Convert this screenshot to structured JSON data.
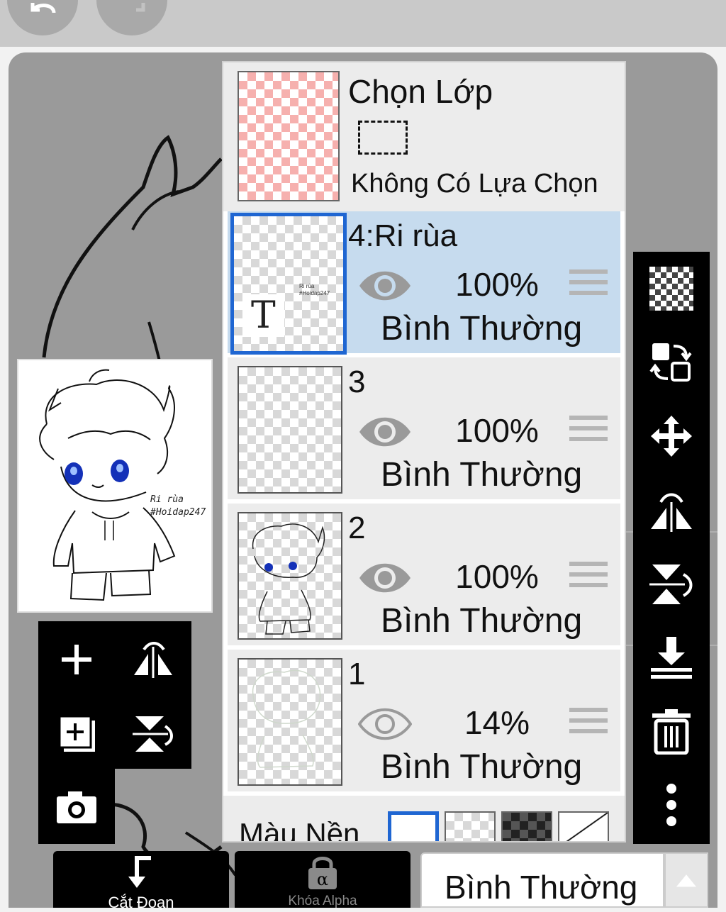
{
  "toolbar": {
    "undo": "undo-icon",
    "redo": "redo-icon"
  },
  "preview": {
    "signature_line1": "Ri rùa",
    "signature_line2": "#Hoidap247"
  },
  "layer_panel": {
    "selection": {
      "title": "Chọn Lớp",
      "status": "Không Có Lựa Chọn"
    },
    "layers": [
      {
        "name": "4:Ri rùa",
        "opacity": "100%",
        "blend": "Bình Thường",
        "visible": true,
        "selected": true,
        "text_layer_marker": "T",
        "thumb_text1": "Ri rùa",
        "thumb_text2": "#Hoidap247"
      },
      {
        "name": "3",
        "opacity": "100%",
        "blend": "Bình Thường",
        "visible": true,
        "selected": false
      },
      {
        "name": "2",
        "opacity": "100%",
        "blend": "Bình Thường",
        "visible": true,
        "selected": false
      },
      {
        "name": "1",
        "opacity": "14%",
        "blend": "Bình Thường",
        "visible": true,
        "selected": false
      }
    ],
    "background": {
      "label": "Màu Nền"
    }
  },
  "bottom": {
    "clip_label": "Cắt Đoạn",
    "alpha_lock_label": "Khóa Alpha",
    "alpha_symbol": "α",
    "blend_mode": "Bình Thường"
  },
  "colors": {
    "selected_layer_bg": "#c6dbee",
    "selected_border": "#1f66d2",
    "panel_bg": "#ececec",
    "tool_bg": "#000000"
  }
}
